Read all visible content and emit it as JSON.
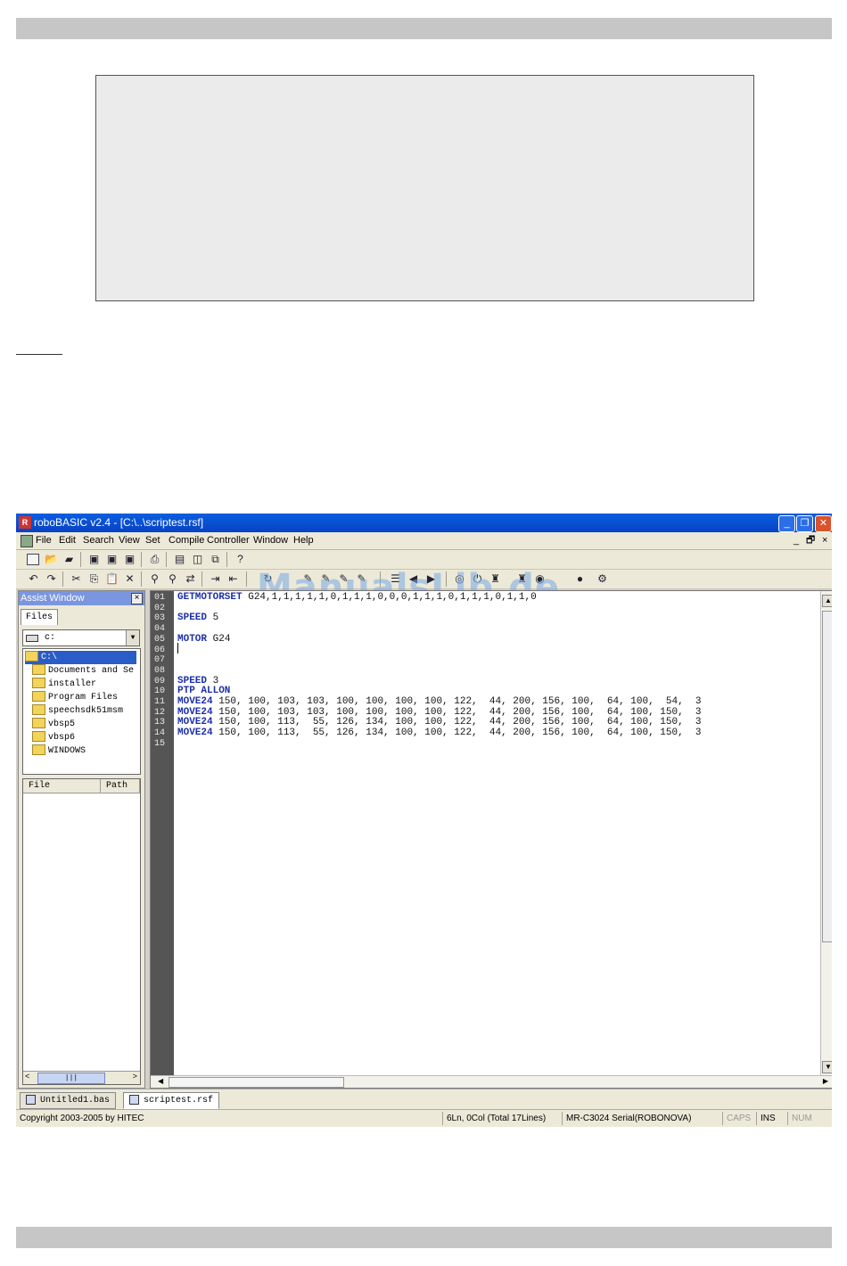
{
  "app": {
    "title": "roboBASIC v2.4 - [C:\\..\\scriptest.rsf]",
    "window_controls": {
      "minimize": "_",
      "maximize": "❐",
      "close": "✕"
    },
    "watermark": "ManualsLib.de"
  },
  "menu": {
    "items": [
      "File",
      "Edit",
      "Search",
      "View",
      "Set",
      "Compile",
      "Controller",
      "Window",
      "Help"
    ],
    "child_controls": [
      "_",
      "🗗",
      "×"
    ]
  },
  "toolbar1": {
    "icons": [
      "new-icon",
      "open-icon",
      "import-icon",
      "save-icon",
      "save-all-icon",
      "save-as-icon",
      "print-icon",
      "window-icon",
      "tile-icon",
      "cascade-icon",
      "help-icon"
    ]
  },
  "toolbar2": {
    "icons": [
      "undo-icon",
      "redo-icon",
      "cut-icon",
      "copy-icon",
      "paste-icon",
      "delete-icon",
      "find-icon",
      "find-next-icon",
      "replace-icon",
      "indent-icon",
      "outdent-icon"
    ]
  },
  "assist": {
    "title": "Assist Window",
    "close": "×",
    "tab": "Files",
    "drive": "c:",
    "tree": [
      {
        "label": "C:\\",
        "selected": true
      },
      {
        "label": "Documents and Se",
        "selected": false
      },
      {
        "label": "installer",
        "selected": false
      },
      {
        "label": "Program Files",
        "selected": false
      },
      {
        "label": "speechsdk51msm",
        "selected": false
      },
      {
        "label": "vbsp5",
        "selected": false
      },
      {
        "label": "vbsp6",
        "selected": false
      },
      {
        "label": "WINDOWS",
        "selected": false
      }
    ],
    "columns": [
      "File",
      "Path"
    ],
    "scroll": {
      "left": "<",
      "thumb": "|||",
      "right": ">"
    }
  },
  "editor": {
    "line_numbers": [
      "01",
      "02",
      "03",
      "04",
      "05",
      "06",
      "07",
      "08",
      "09",
      "10",
      "11",
      "12",
      "13",
      "14",
      "15"
    ],
    "lines": [
      {
        "kw": "GETMOTORSET",
        "rest": " G24,1,1,1,1,1,0,1,1,1,0,0,0,1,1,1,0,1,1,1,0,1,1,0"
      },
      {
        "kw": "",
        "rest": ""
      },
      {
        "kw": "SPEED",
        "rest": " 5"
      },
      {
        "kw": "",
        "rest": ""
      },
      {
        "kw": "MOTOR",
        "rest": " G24"
      },
      {
        "kw": "",
        "rest": ""
      },
      {
        "kw": "",
        "rest": ""
      },
      {
        "kw": "",
        "rest": ""
      },
      {
        "kw": "SPEED",
        "rest": " 3"
      },
      {
        "kw": "PTP ALLON",
        "rest": ""
      },
      {
        "kw": "MOVE24",
        "rest": " 150, 100, 103, 103, 100, 100, 100, 100, 122,  44, 200, 156, 100,  64, 100,  54,  3"
      },
      {
        "kw": "MOVE24",
        "rest": " 150, 100, 103, 103, 100, 100, 100, 100, 122,  44, 200, 156, 100,  64, 100, 150,  3"
      },
      {
        "kw": "MOVE24",
        "rest": " 150, 100, 113,  55, 126, 134, 100, 100, 122,  44, 200, 156, 100,  64, 100, 150,  3"
      },
      {
        "kw": "MOVE24",
        "rest": " 150, 100, 113,  55, 126, 134, 100, 100, 122,  44, 200, 156, 100,  64, 100, 150,  3"
      },
      {
        "kw": "",
        "rest": ""
      }
    ]
  },
  "doc_tabs": [
    "Untitled1.bas",
    "scriptest.rsf"
  ],
  "status": {
    "copyright": "Copyright 2003-2005 by HITEC",
    "position": "6Ln, 0Col (Total 17Lines)",
    "device": "MR-C3024 Serial(ROBONOVA)",
    "caps": "CAPS",
    "ins": "INS",
    "num": "NUM"
  }
}
